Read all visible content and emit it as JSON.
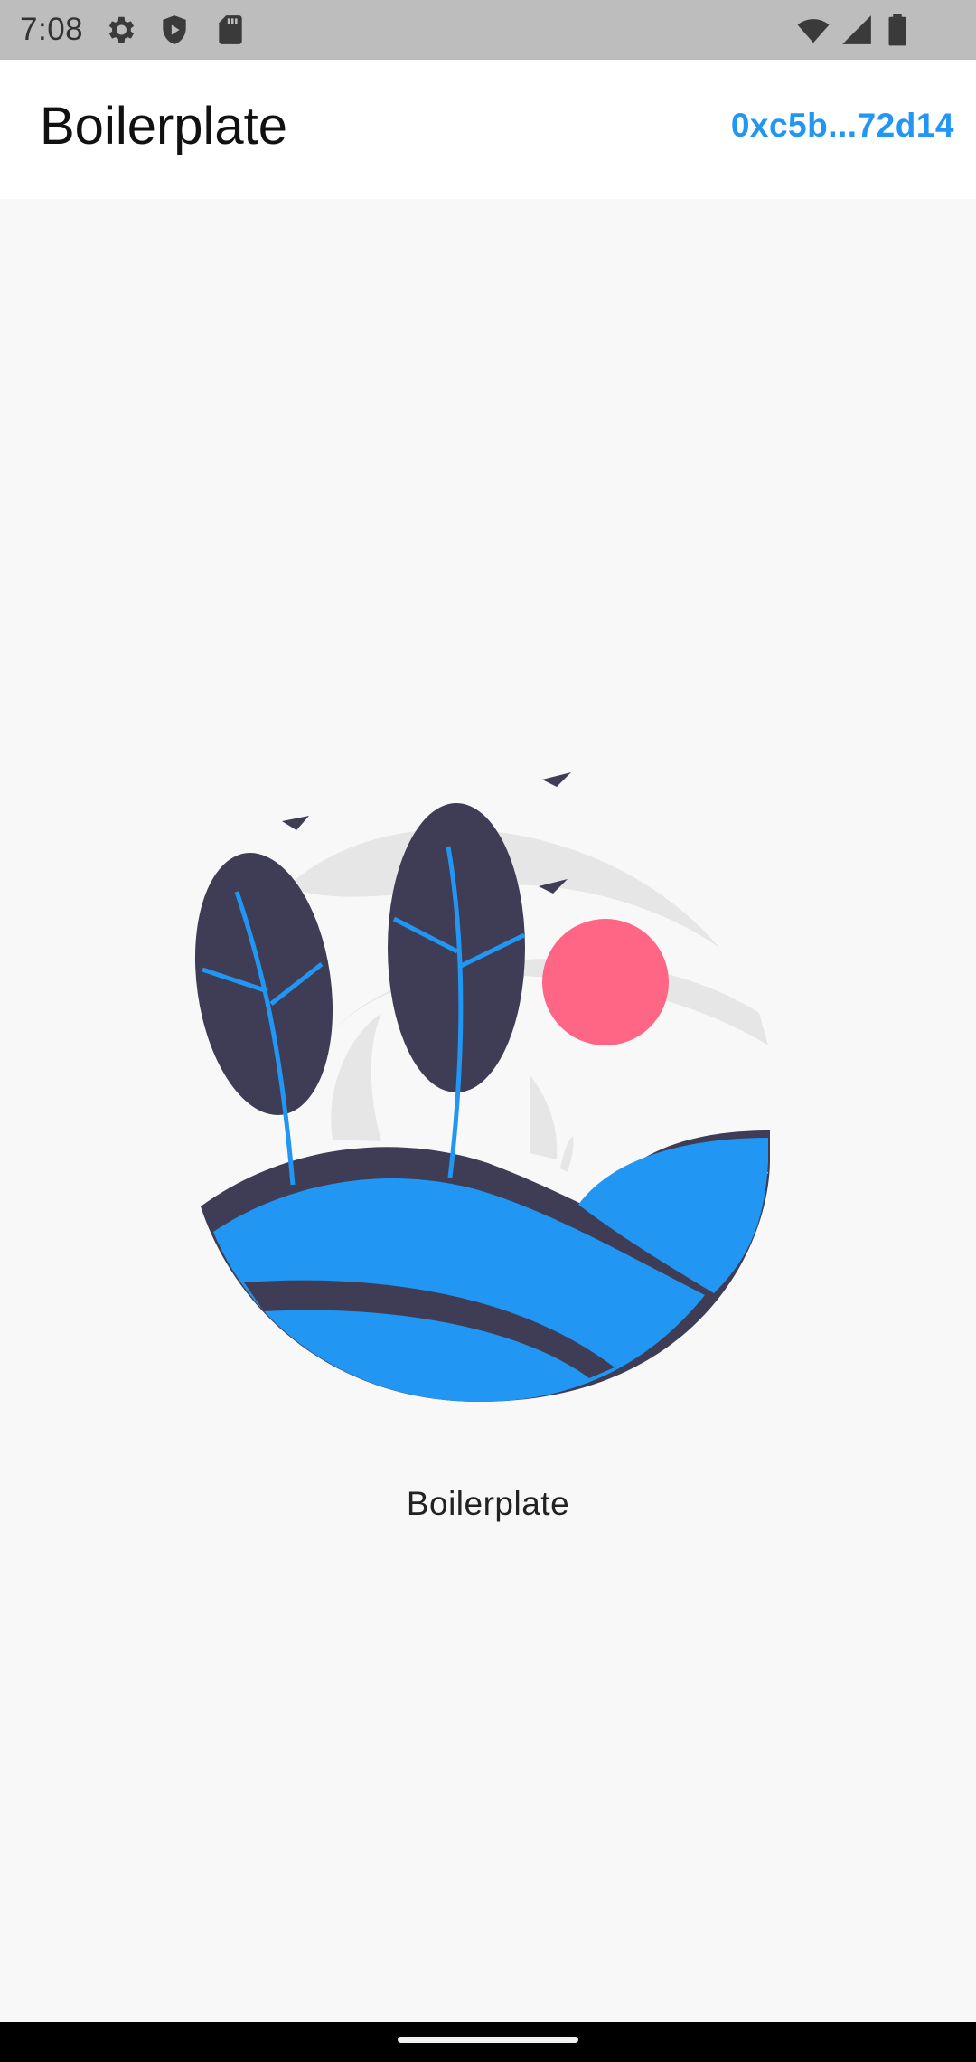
{
  "status_bar": {
    "time": "7:08",
    "icons_left": [
      "settings-icon",
      "shield-play-icon",
      "sd-card-icon"
    ],
    "icons_right": [
      "wifi-icon",
      "cell-signal-icon",
      "battery-icon"
    ]
  },
  "app_bar": {
    "title": "Boilerplate",
    "account_label": "0xc5b...72d14",
    "accent_color": "#2196f3"
  },
  "main": {
    "illustration": "landscape-illustration",
    "caption": "Boilerplate"
  },
  "colors": {
    "background": "#f8f8f8",
    "dark": "#3f3d56",
    "blue": "#2196f3",
    "sun": "#ff6584",
    "light_gray": "#e6e6e6"
  }
}
